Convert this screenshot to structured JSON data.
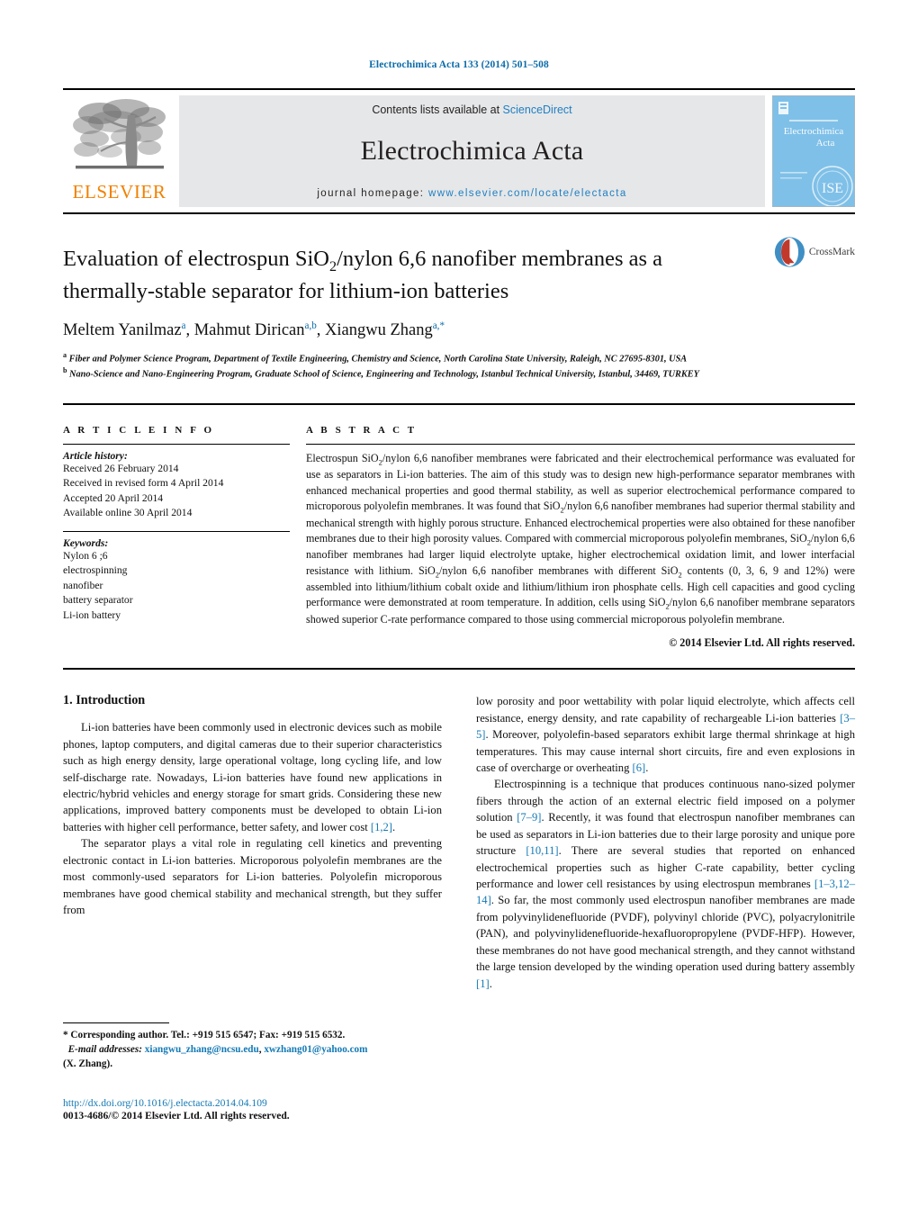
{
  "running_head": "Electrochimica Acta 133 (2014) 501–508",
  "masthead": {
    "publisher_name": "ELSEVIER",
    "contents_prefix": "Contents lists available at ",
    "contents_link": "ScienceDirect",
    "journal_title": "Electrochimica Acta",
    "homepage_prefix": "journal homepage: ",
    "homepage_url": "www.elsevier.com/locate/electacta",
    "cover_line1": "Electrochimica",
    "cover_line2": "Acta",
    "cover_emblem": "ISE",
    "cover_color": "#7fc0e8"
  },
  "article": {
    "title_part1": "Evaluation of electrospun SiO",
    "title_sub": "2",
    "title_part2": "/nylon 6,6 nanofiber membranes as a thermally-stable separator for lithium-ion batteries",
    "crossmark_label": "CrossMark",
    "authors": [
      {
        "name": "Meltem Yanilmaz",
        "marks": "a"
      },
      {
        "name": "Mahmut Dirican",
        "marks": "a,b"
      },
      {
        "name": "Xiangwu Zhang",
        "marks": "a,*"
      }
    ],
    "affiliations": [
      {
        "mark": "a",
        "text": "Fiber and Polymer Science Program, Department of Textile Engineering, Chemistry and Science, North Carolina State University, Raleigh, NC 27695-8301, USA"
      },
      {
        "mark": "b",
        "text": "Nano-Science and Nano-Engineering Program, Graduate School of Science, Engineering and Technology, Istanbul Technical University, Istanbul, 34469, TURKEY"
      }
    ]
  },
  "article_info": {
    "heading": "A R T I C L E   I N F O",
    "history_label": "Article history:",
    "history": [
      "Received 26 February 2014",
      "Received in revised form 4 April 2014",
      "Accepted 20 April 2014",
      "Available online 30 April 2014"
    ],
    "keywords_label": "Keywords:",
    "keywords": [
      "Nylon 6 ;6",
      "electrospinning",
      "nanofiber",
      "battery separator",
      "Li-ion battery"
    ]
  },
  "abstract": {
    "heading": "A B S T R A C T",
    "text": "Electrospun SiO2/nylon 6,6 nanofiber membranes were fabricated and their electrochemical performance was evaluated for use as separators in Li-ion batteries. The aim of this study was to design new high-performance separator membranes with enhanced mechanical properties and good thermal stability, as well as superior electrochemical performance compared to microporous polyolefin membranes. It was found that SiO2/nylon 6,6 nanofiber membranes had superior thermal stability and mechanical strength with highly porous structure. Enhanced electrochemical properties were also obtained for these nanofiber membranes due to their high porosity values. Compared with commercial microporous polyolefin membranes, SiO2/nylon 6,6 nanofiber membranes had larger liquid electrolyte uptake, higher electrochemical oxidation limit, and lower interfacial resistance with lithium. SiO2/nylon 6,6 nanofiber membranes with different SiO2 contents (0, 3, 6, 9 and 12%) were assembled into lithium/lithium cobalt oxide and lithium/lithium iron phosphate cells. High cell capacities and good cycling performance were demonstrated at room temperature. In addition, cells using SiO2/nylon 6,6 nanofiber membrane separators showed superior C-rate performance compared to those using commercial microporous polyolefin membrane.",
    "copyright": "© 2014 Elsevier Ltd. All rights reserved."
  },
  "introduction": {
    "heading": "1.  Introduction",
    "left_paragraphs": [
      "Li-ion batteries have been commonly used in electronic devices such as mobile phones, laptop computers, and digital cameras due to their superior characteristics such as high energy density, large operational voltage, long cycling life, and low self-discharge rate. Nowadays, Li-ion batteries have found new applications in electric/hybrid vehicles and energy storage for smart grids. Considering these new applications, improved battery components must be developed to obtain Li-ion batteries with higher cell performance, better safety, and lower cost [1,2].",
      "The separator plays a vital role in regulating cell kinetics and preventing electronic contact in Li-ion batteries. Microporous polyolefin membranes are the most commonly-used separators for Li-ion batteries. Polyolefin microporous membranes have good chemical stability and mechanical strength, but they suffer from"
    ],
    "right_paragraphs": [
      "low porosity and poor wettability with polar liquid electrolyte, which affects cell resistance, energy density, and rate capability of rechargeable Li-ion batteries [3–5]. Moreover, polyolefin-based separators exhibit large thermal shrinkage at high temperatures. This may cause internal short circuits, fire and even explosions in case of overcharge or overheating [6].",
      "Electrospinning is a technique that produces continuous nano-sized polymer fibers through the action of an external electric field imposed on a polymer solution [7–9]. Recently, it was found that electrospun nanofiber membranes can be used as separators in Li-ion batteries due to their large porosity and unique pore structure [10,11]. There are several studies that reported on enhanced electrochemical properties such as higher C-rate capability, better cycling performance and lower cell resistances by using electrospun membranes [1–3,12–14]. So far, the most commonly used electrospun nanofiber membranes are made from polyvinylidenefluoride (PVDF), polyvinyl chloride (PVC), polyacrylonitrile (PAN), and polyvinylidenefluoride-hexafluoropropylene (PVDF-HFP). However, these membranes do not have good mechanical strength, and they cannot withstand the large tension developed by the winding operation used during battery assembly [1]."
    ]
  },
  "footnote": {
    "corresponding": "*  Corresponding author. Tel.: +919 515 6547; Fax: +919 515 6532.",
    "email_label": "E-mail addresses:",
    "email1": "xiangwu_zhang@ncsu.edu",
    "email_sep": ", ",
    "email2": "xwzhang01@yahoo.com",
    "email_owner": "(X. Zhang)."
  },
  "doi_block": {
    "doi": "http://dx.doi.org/10.1016/j.electacta.2014.04.109",
    "issn_line": "0013-4686/© 2014 Elsevier Ltd. All rights reserved."
  },
  "colors": {
    "link_blue": "#1479b5",
    "head_blue": "#0b6ba8",
    "elsevier_orange": "#f08100",
    "banner_gray": "#e6e7e8"
  }
}
